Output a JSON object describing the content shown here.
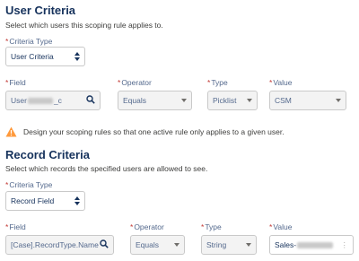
{
  "colors": {
    "warning": "#ff9a3c",
    "required": "#c23934"
  },
  "user_criteria": {
    "title": "User Criteria",
    "description": "Select which users this scoping rule applies to.",
    "criteria_type": {
      "label": "Criteria Type",
      "value": "User Criteria"
    },
    "field": {
      "label": "Field",
      "value_start": "User",
      "value_end": "_c"
    },
    "operator": {
      "label": "Operator",
      "value": "Equals"
    },
    "type": {
      "label": "Type",
      "value": "Picklist"
    },
    "value": {
      "label": "Value",
      "value": "CSM"
    }
  },
  "warning": {
    "icon": "warning-icon",
    "text": "Design your scoping rules so that one active rule only applies to a given user."
  },
  "record_criteria": {
    "title": "Record Criteria",
    "description": "Select which records the specified users are allowed to see.",
    "criteria_type": {
      "label": "Criteria Type",
      "value": "Record Field"
    },
    "field": {
      "label": "Field",
      "value": "[Case].RecordType.Name"
    },
    "operator": {
      "label": "Operator",
      "value": "Equals"
    },
    "type": {
      "label": "Type",
      "value": "String"
    },
    "value": {
      "label": "Value",
      "value": "Sales-"
    }
  }
}
